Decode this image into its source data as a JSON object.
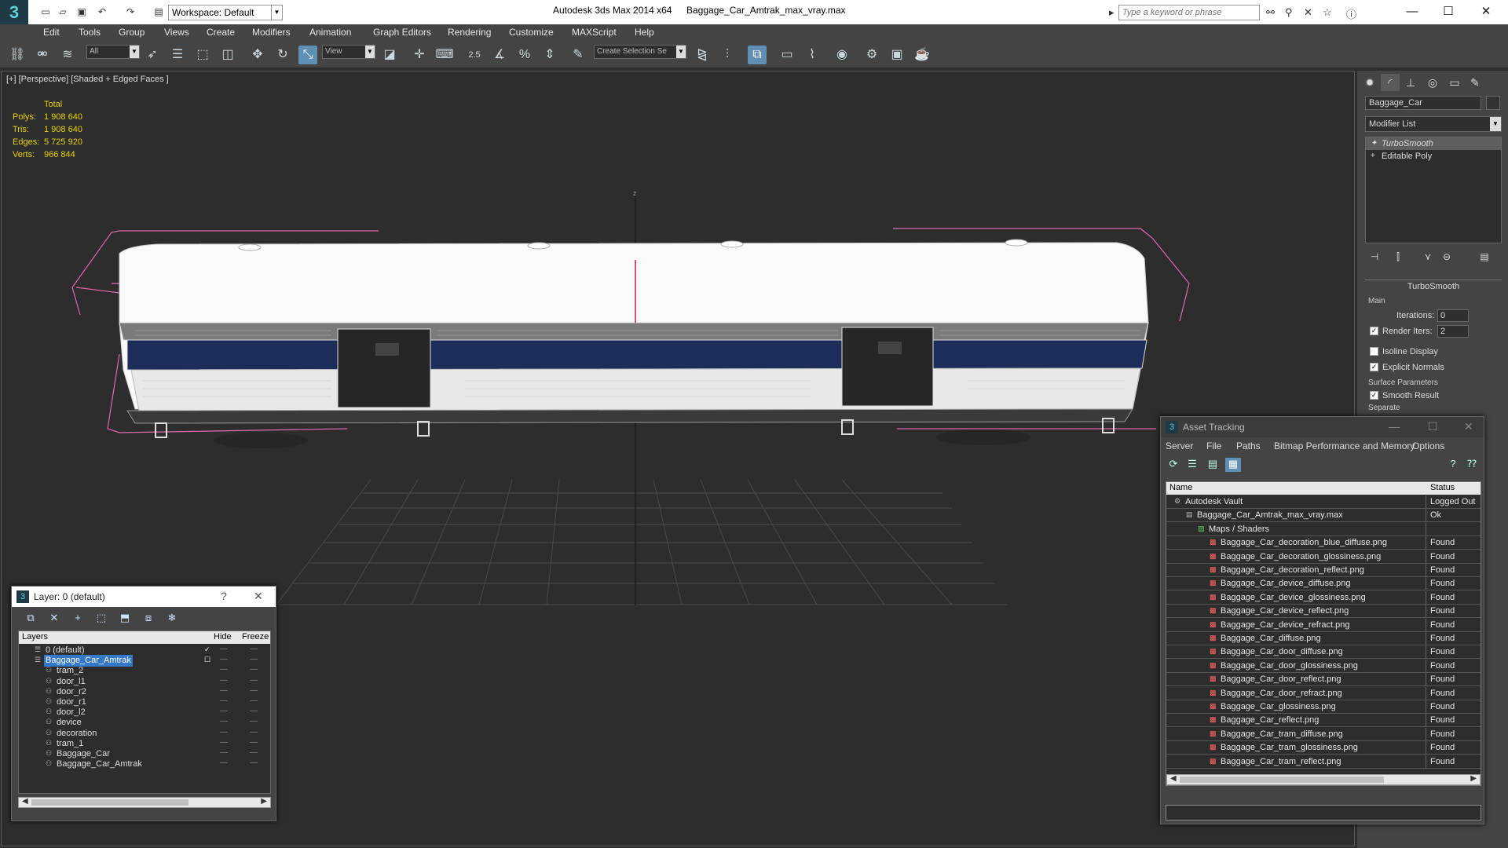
{
  "titlebar": {
    "workspace": "Workspace: Default",
    "app_title": "Autodesk 3ds Max 2014 x64",
    "document": "Baggage_Car_Amtrak_max_vray.max",
    "search_placeholder": "Type a keyword or phrase"
  },
  "menu": [
    "Edit",
    "Tools",
    "Group",
    "Views",
    "Create",
    "Modifiers",
    "Animation",
    "Graph Editors",
    "Rendering",
    "Customize",
    "MAXScript",
    "Help"
  ],
  "toolbar": {
    "filter": "All",
    "refcoord": "View",
    "snap_label": "2.5",
    "selection_set": "Create Selection Se"
  },
  "viewport": {
    "label": "[+] [Perspective] [Shaded + Edged Faces ]",
    "axis_label": "z",
    "stats": {
      "header": "Total",
      "rows": [
        {
          "label": "Polys:",
          "value": "1 908 640"
        },
        {
          "label": "Tris:",
          "value": "1 908 640"
        },
        {
          "label": "Edges:",
          "value": "5 725 920"
        },
        {
          "label": "Verts:",
          "value": "966 844"
        }
      ]
    }
  },
  "command_panel": {
    "object_name": "Baggage_Car",
    "modifier_list": "Modifier List",
    "stack": [
      "TurboSmooth",
      "Editable Poly"
    ],
    "turbosmooth": {
      "title": "TurboSmooth",
      "main": "Main",
      "iterations_label": "Iterations:",
      "iterations": "0",
      "render_iters_label": "Render Iters:",
      "render_iters": "2",
      "isoline": "Isoline Display",
      "explicit_normals": "Explicit Normals",
      "surface_params": "Surface Parameters",
      "smooth_result": "Smooth Result",
      "separate": "Separate"
    }
  },
  "layer_dialog": {
    "title": "Layer: 0 (default)",
    "help": "?",
    "columns": [
      "Layers",
      "Hide",
      "Freeze"
    ],
    "rows": [
      {
        "name": "0 (default)",
        "level": 0
      },
      {
        "name": "Baggage_Car_Amtrak",
        "level": 0,
        "selected": true
      },
      {
        "name": "tram_2",
        "level": 1
      },
      {
        "name": "door_l1",
        "level": 1
      },
      {
        "name": "door_r2",
        "level": 1
      },
      {
        "name": "door_r1",
        "level": 1
      },
      {
        "name": "door_l2",
        "level": 1
      },
      {
        "name": "device",
        "level": 1
      },
      {
        "name": "decoration",
        "level": 1
      },
      {
        "name": "tram_1",
        "level": 1
      },
      {
        "name": "Baggage_Car",
        "level": 1
      },
      {
        "name": "Baggage_Car_Amtrak",
        "level": 1
      }
    ]
  },
  "asset_dialog": {
    "title": "Asset Tracking",
    "menu": [
      "Server",
      "File",
      "Paths",
      "Bitmap Performance and Memory",
      "Options"
    ],
    "columns": [
      "Name",
      "Status"
    ],
    "rows": [
      {
        "name": "Autodesk Vault",
        "status": "Logged Out",
        "level": 0
      },
      {
        "name": "Baggage_Car_Amtrak_max_vray.max",
        "status": "Ok",
        "level": 1
      },
      {
        "name": "Maps / Shaders",
        "status": "",
        "level": 2
      },
      {
        "name": "Baggage_Car_decoration_blue_diffuse.png",
        "status": "Found",
        "level": 3
      },
      {
        "name": "Baggage_Car_decoration_glossiness.png",
        "status": "Found",
        "level": 3
      },
      {
        "name": "Baggage_Car_decoration_reflect.png",
        "status": "Found",
        "level": 3
      },
      {
        "name": "Baggage_Car_device_diffuse.png",
        "status": "Found",
        "level": 3
      },
      {
        "name": "Baggage_Car_device_glossiness.png",
        "status": "Found",
        "level": 3
      },
      {
        "name": "Baggage_Car_device_reflect.png",
        "status": "Found",
        "level": 3
      },
      {
        "name": "Baggage_Car_device_refract.png",
        "status": "Found",
        "level": 3
      },
      {
        "name": "Baggage_Car_diffuse.png",
        "status": "Found",
        "level": 3
      },
      {
        "name": "Baggage_Car_door_diffuse.png",
        "status": "Found",
        "level": 3
      },
      {
        "name": "Baggage_Car_door_glossiness.png",
        "status": "Found",
        "level": 3
      },
      {
        "name": "Baggage_Car_door_reflect.png",
        "status": "Found",
        "level": 3
      },
      {
        "name": "Baggage_Car_door_refract.png",
        "status": "Found",
        "level": 3
      },
      {
        "name": "Baggage_Car_glossiness.png",
        "status": "Found",
        "level": 3
      },
      {
        "name": "Baggage_Car_reflect.png",
        "status": "Found",
        "level": 3
      },
      {
        "name": "Baggage_Car_tram_diffuse.png",
        "status": "Found",
        "level": 3
      },
      {
        "name": "Baggage_Car_tram_glossiness.png",
        "status": "Found",
        "level": 3
      },
      {
        "name": "Baggage_Car_tram_reflect.png",
        "status": "Found",
        "level": 3
      }
    ]
  },
  "colors": {
    "accent": "#5f8fb5",
    "selection": "#3478c9",
    "stats": "#e8d400",
    "bbox": "#e06ab0"
  }
}
